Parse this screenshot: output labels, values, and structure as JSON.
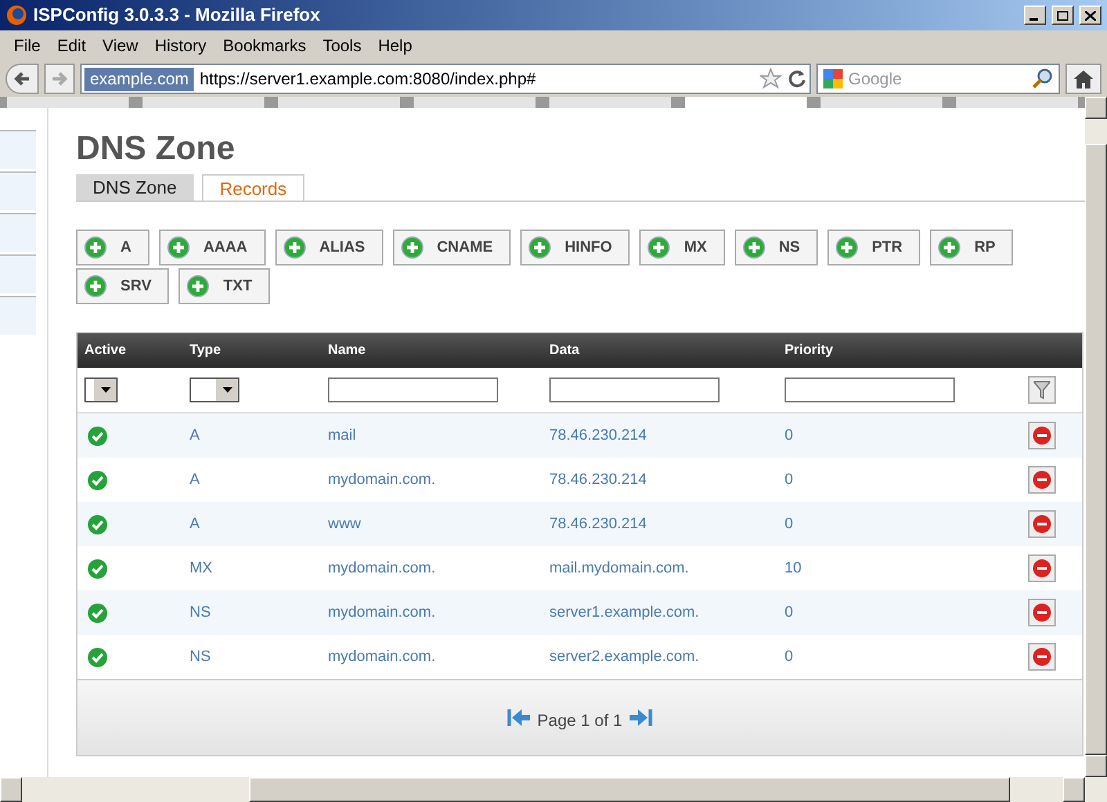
{
  "window": {
    "title": "ISPConfig 3.0.3.3 - Mozilla Firefox"
  },
  "menu": [
    "File",
    "Edit",
    "View",
    "History",
    "Bookmarks",
    "Tools",
    "Help"
  ],
  "url_bar": {
    "site": "example.com",
    "url": "https://server1.example.com:8080/index.php#"
  },
  "search": {
    "placeholder": "Google"
  },
  "top_tabs": [
    {
      "selected": false
    },
    {
      "selected": false
    },
    {
      "selected": false
    },
    {
      "selected": false
    },
    {
      "selected": false
    },
    {
      "selected": true
    },
    {
      "selected": false
    },
    {
      "selected": false
    }
  ],
  "page_title": "DNS Zone",
  "tabs": [
    {
      "label": "DNS Zone",
      "selected": false
    },
    {
      "label": "Records",
      "selected": true
    }
  ],
  "add_buttons": [
    "A",
    "AAAA",
    "ALIAS",
    "CNAME",
    "HINFO",
    "MX",
    "NS",
    "PTR",
    "RP",
    "SRV",
    "TXT"
  ],
  "table": {
    "columns": [
      "Active",
      "Type",
      "Name",
      "Data",
      "Priority"
    ],
    "rows": [
      {
        "active": true,
        "type": "A",
        "name": "mail",
        "data": "78.46.230.214",
        "priority": "0"
      },
      {
        "active": true,
        "type": "A",
        "name": "mydomain.com.",
        "data": "78.46.230.214",
        "priority": "0"
      },
      {
        "active": true,
        "type": "A",
        "name": "www",
        "data": "78.46.230.214",
        "priority": "0"
      },
      {
        "active": true,
        "type": "MX",
        "name": "mydomain.com.",
        "data": "mail.mydomain.com.",
        "priority": "10"
      },
      {
        "active": true,
        "type": "NS",
        "name": "mydomain.com.",
        "data": "server1.example.com.",
        "priority": "0"
      },
      {
        "active": true,
        "type": "NS",
        "name": "mydomain.com.",
        "data": "server2.example.com.",
        "priority": "0"
      }
    ]
  },
  "pager": "Page 1 of 1"
}
